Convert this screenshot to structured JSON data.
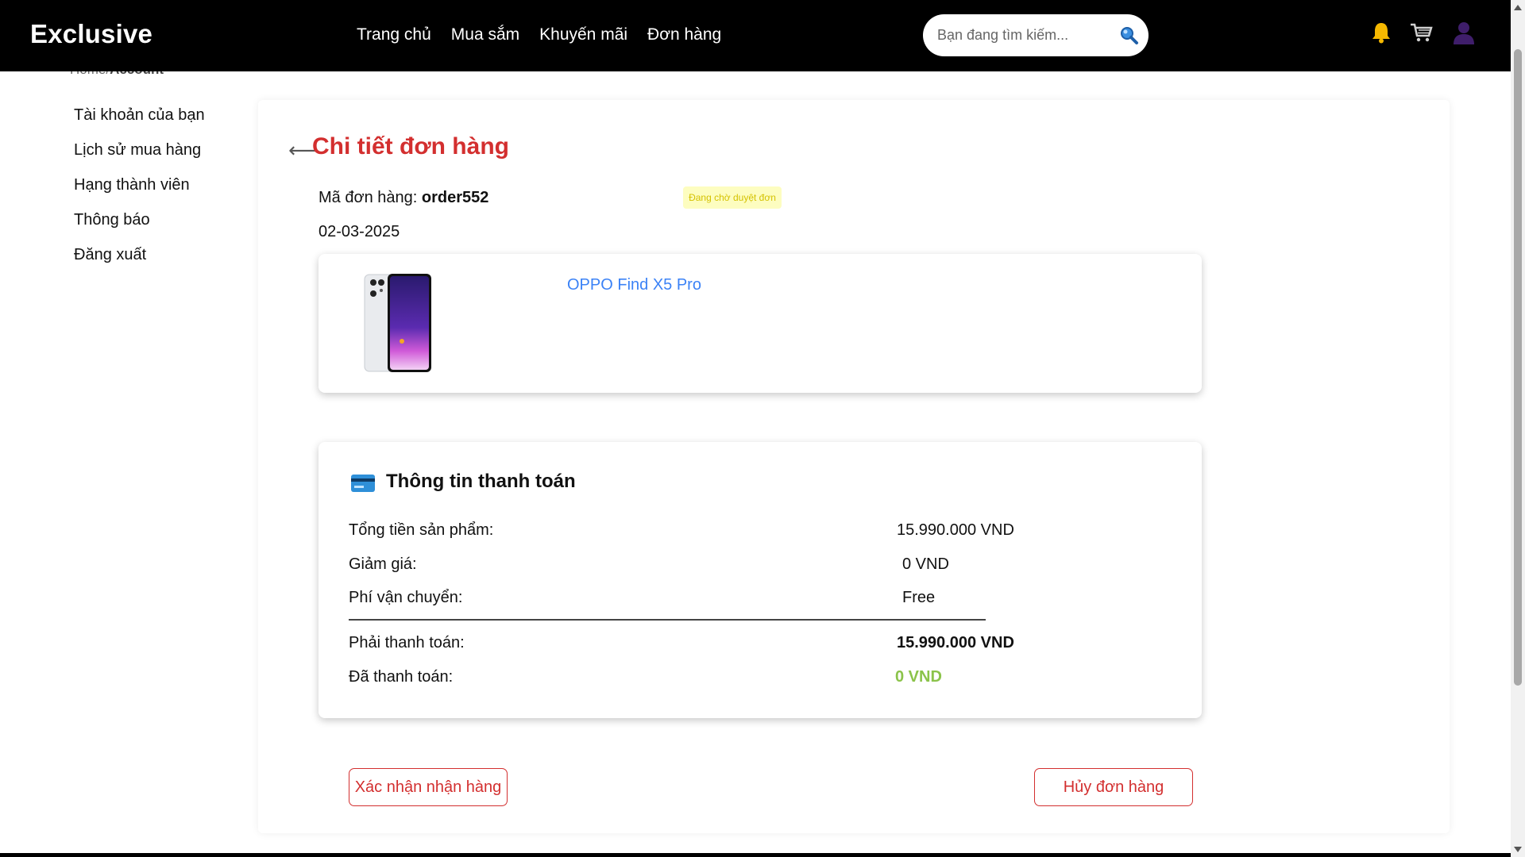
{
  "header": {
    "brand": "Exclusive",
    "nav": [
      "Trang chủ",
      "Mua sắm",
      "Khuyến mãi",
      "Đơn hàng"
    ],
    "search_placeholder": "Bạn đang tìm kiếm..."
  },
  "breadcrumb": {
    "home": "Home/",
    "current": "Account"
  },
  "sidebar": {
    "items": [
      "Tài khoản của bạn",
      "Lịch sử mua hàng",
      "Hạng thành viên",
      "Thông báo",
      "Đăng xuất"
    ]
  },
  "order": {
    "back_arrow": "⟵",
    "title": "Chi tiết đơn hàng",
    "id_label": "Mã đơn hàng: ",
    "id_value": "order552",
    "status": "Đang chờ duyệt đơn",
    "date": "02-03-2025"
  },
  "product": {
    "name": "OPPO Find X5 Pro"
  },
  "payment": {
    "title": "Thông tin thanh toán",
    "subtotal_label": "Tổng tiền sản phẩm:",
    "subtotal_value": "15.990.000 VND",
    "discount_label": "Giảm giá:",
    "discount_value": "0 VND",
    "shipping_label": "Phí vận chuyển:",
    "shipping_value": "Free",
    "total_label": "Phải thanh toán:",
    "total_value": "15.990.000 VND",
    "paid_label": "Đã thanh toán:",
    "paid_value": "0 VND"
  },
  "actions": {
    "confirm": "Xác nhận nhận hàng",
    "cancel": "Hủy đơn hàng"
  },
  "colors": {
    "accent": "#d32f2f",
    "link": "#3b82f6",
    "paid": "#8bc34a",
    "status_bg": "#fdfdc0",
    "status_text": "#d4c200"
  }
}
